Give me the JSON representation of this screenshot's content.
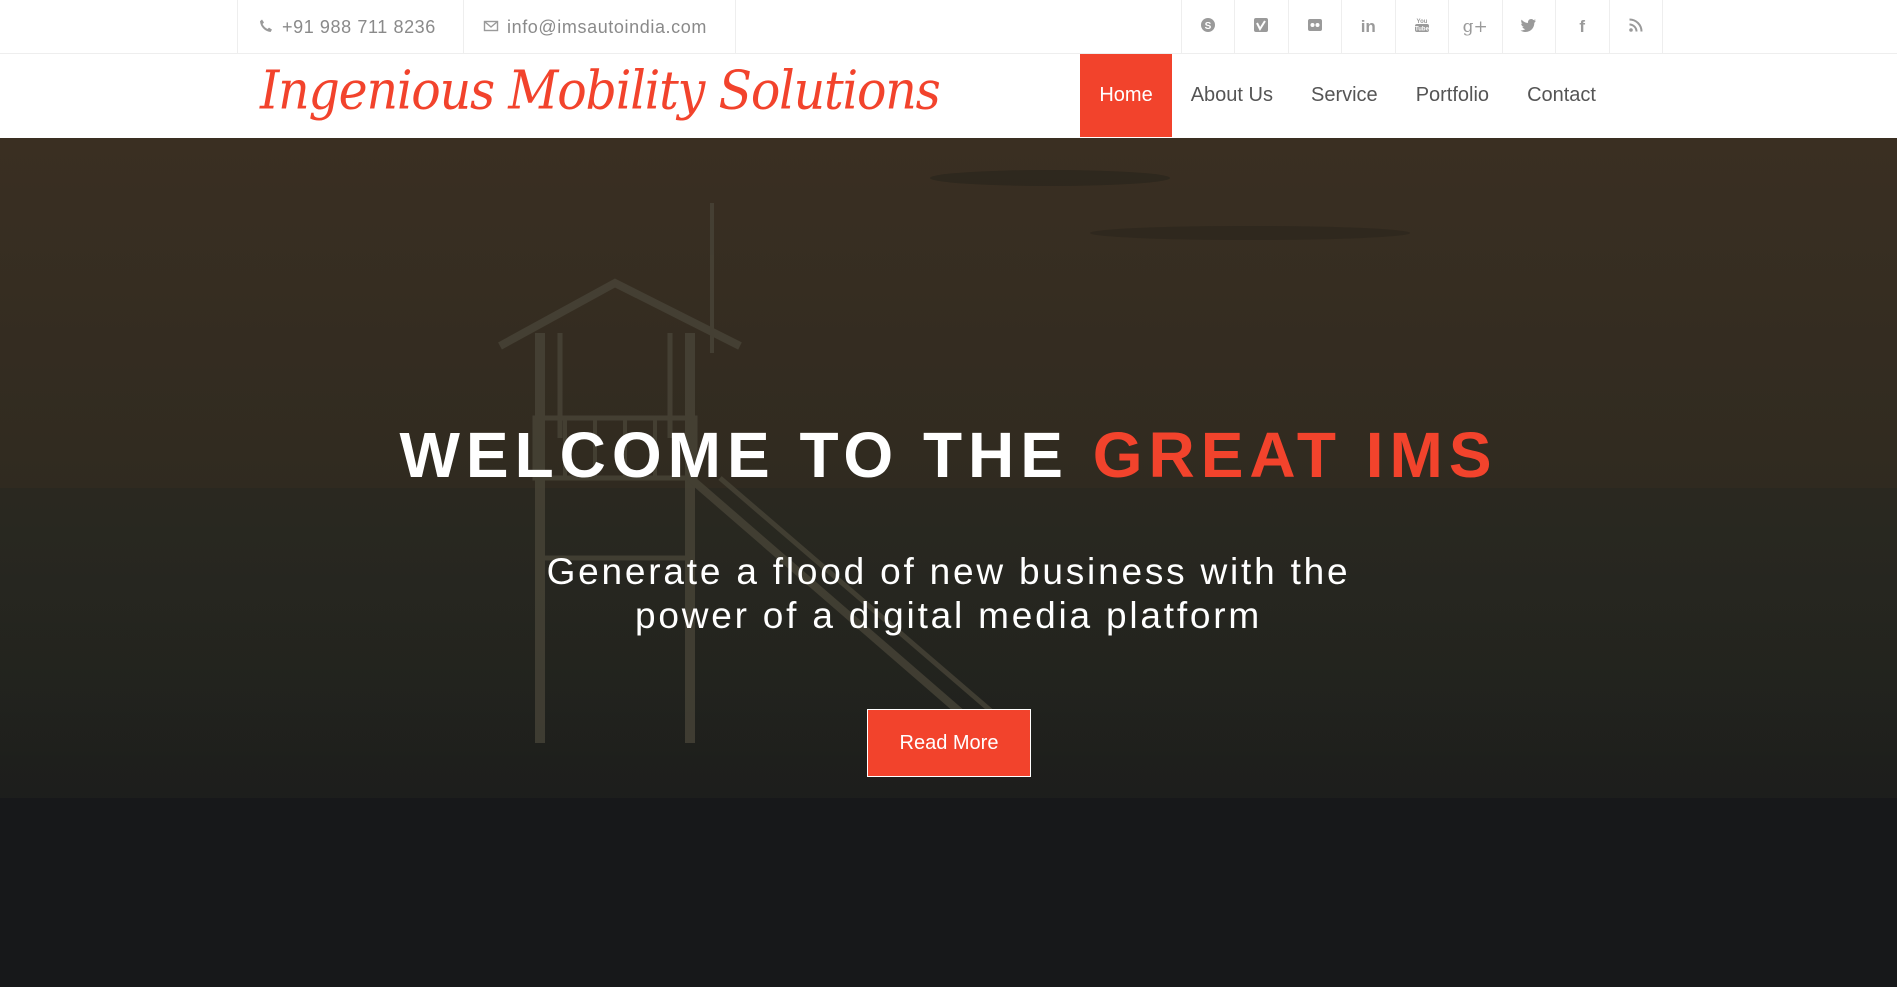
{
  "topbar": {
    "phone": "+91 988 711 8236",
    "email": "info@imsautoindia.com",
    "phone_icon": "phone-icon",
    "email_icon": "envelope-icon",
    "social": [
      {
        "name": "skype-icon",
        "glyph": "S"
      },
      {
        "name": "vimeo-icon",
        "glyph": "V"
      },
      {
        "name": "flickr-icon",
        "glyph": "••"
      },
      {
        "name": "linkedin-icon",
        "glyph": "in"
      },
      {
        "name": "youtube-icon",
        "glyph": "You"
      },
      {
        "name": "google-plus-icon",
        "glyph": "g+"
      },
      {
        "name": "twitter-icon",
        "glyph": "t"
      },
      {
        "name": "facebook-icon",
        "glyph": "f"
      },
      {
        "name": "rss-icon",
        "glyph": "rss"
      }
    ]
  },
  "header": {
    "logo_text": "Ingenious Mobility Solutions",
    "nav": [
      {
        "label": "Home",
        "active": true
      },
      {
        "label": "About Us",
        "active": false
      },
      {
        "label": "Service",
        "active": false
      },
      {
        "label": "Portfolio",
        "active": false
      },
      {
        "label": "Contact",
        "active": false
      }
    ]
  },
  "hero": {
    "title_main": "WELCOME TO THE ",
    "title_accent": "GREAT IMS",
    "subtitle_line1": "Generate a flood of new business with the",
    "subtitle_line2": "power of a digital media platform",
    "button_label": "Read More"
  },
  "colors": {
    "accent": "#f2432c",
    "nav_text": "#555555",
    "topbar_text": "#8a8a8a"
  }
}
